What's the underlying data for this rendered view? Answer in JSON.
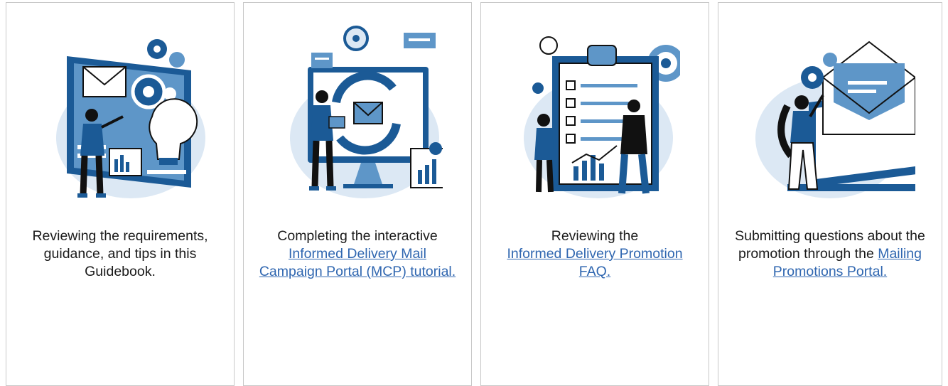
{
  "cards": [
    {
      "icon": "guidebook-review-illustration",
      "text": "Reviewing the requirements, guidance, and tips in this Guidebook.",
      "link": ""
    },
    {
      "icon": "portal-tutorial-illustration",
      "text": "Completing the interactive",
      "link": " Informed Delivery Mail Campaign Portal (MCP) tutorial."
    },
    {
      "icon": "faq-clipboard-illustration",
      "text": "Reviewing the",
      "link": "Informed Delivery Promotion FAQ."
    },
    {
      "icon": "questions-envelope-illustration",
      "text": "Submitting questions about the promotion through the",
      "link": "Mailing Promotions Portal."
    }
  ],
  "colors": {
    "primary": "#1b5a96",
    "light": "#5e96c8",
    "pale": "#dce8f4",
    "dark": "#111111",
    "link": "#2f66b0"
  }
}
